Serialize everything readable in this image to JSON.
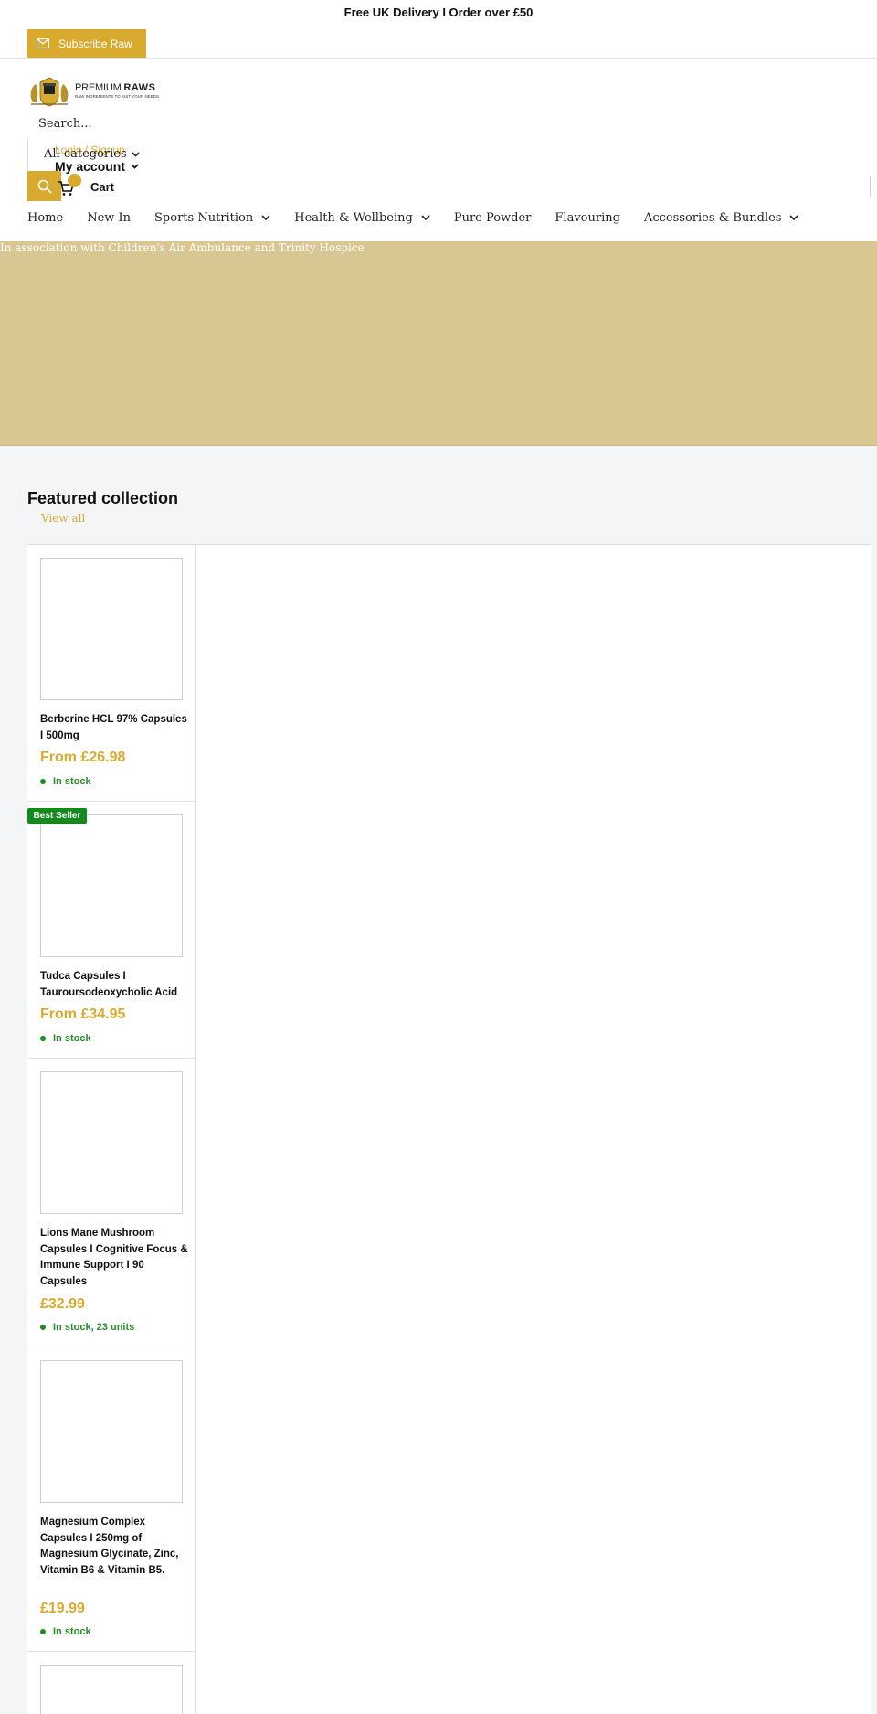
{
  "announcement": "Free UK Delivery  I Order over £50",
  "subscribe": {
    "label": "Subscribe Raw"
  },
  "logo": {
    "brand_prefix": "PREMIUM",
    "brand_name": "RAWS",
    "tagline": "RAW INGREDIENTS TO SUIT YOUR NEEDS"
  },
  "search": {
    "placeholder": "Search...",
    "category_label": "All categories"
  },
  "account": {
    "login_label": "Login / Signup",
    "my_account_label": "My account"
  },
  "cart": {
    "label": "Cart"
  },
  "nav": [
    {
      "label": "Home"
    },
    {
      "label": "New In"
    },
    {
      "label": "Sports Nutrition"
    },
    {
      "label": "Health & Wellbeing"
    },
    {
      "label": "Pure Powder"
    },
    {
      "label": "Flavouring"
    },
    {
      "label": "Accessories & Bundles"
    }
  ],
  "banner": {
    "text": "In association with Children's Air Ambulance and Trinity Hospice"
  },
  "featured": {
    "title": "Featured collection",
    "view_all": "View all",
    "products": [
      {
        "title": "Berberine HCL 97% Capsules I 500mg",
        "price": "From £26.98",
        "stock": "In stock"
      },
      {
        "badge": "Best Seller",
        "title": "Tudca Capsules I Tauroursodeoxycholic Acid",
        "price": "From £34.95",
        "stock": "In stock"
      },
      {
        "title": "Lions Mane Mushroom Capsules I Cognitive Focus & Immune Support I 90 Capsules",
        "price": "£32.99",
        "stock": "In stock, 23 units"
      },
      {
        "title": "Magnesium Complex Capsules I 250mg of Magnesium Glycinate, Zinc, Vitamin B6 & Vitamin B5.",
        "price": "£19.99",
        "stock": "In stock"
      }
    ]
  },
  "colors": {
    "accent": "#d8ab2f",
    "banner": "#d8c793",
    "stock_green": "#1f8a1f",
    "badge_green": "#138a1c"
  }
}
